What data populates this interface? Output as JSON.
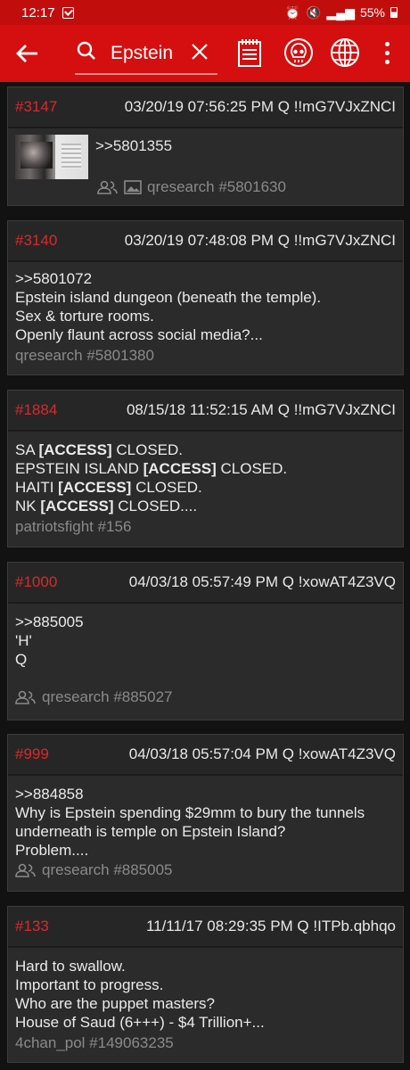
{
  "status_bar": {
    "time": "12:17",
    "battery": "55%"
  },
  "toolbar": {
    "search_text": "Epstein"
  },
  "posts": [
    {
      "num": "#3147",
      "meta": "03/20/19 07:56:25 PM Q !!mG7VJxZNCI",
      "body": [
        ">>5801355"
      ],
      "footer": "qresearch #5801630"
    },
    {
      "num": "#3140",
      "meta": "03/20/19 07:48:08 PM Q !!mG7VJxZNCI",
      "body": [
        ">>5801072",
        "Epstein island dungeon (beneath the temple).",
        "Sex & torture rooms.",
        "Openly flaunt across social media?..."
      ],
      "footer": "qresearch #5801380"
    },
    {
      "num": "#1884",
      "meta": "08/15/18 11:52:15 AM Q !!mG7VJxZNCI",
      "body": [
        {
          "a": "SA ",
          "b": "[ACCESS]",
          "c": " CLOSED."
        },
        {
          "a": "EPSTEIN ISLAND ",
          "b": "[ACCESS]",
          "c": " CLOSED."
        },
        {
          "a": "HAITI ",
          "b": "[ACCESS]",
          "c": " CLOSED."
        },
        {
          "a": "NK ",
          "b": "[ACCESS]",
          "c": " CLOSED...."
        }
      ],
      "footer": "patriotsfight #156"
    },
    {
      "num": "#1000",
      "meta": "04/03/18 05:57:49 PM Q !xowAT4Z3VQ",
      "body": [
        ">>885005",
        "'H'",
        "Q"
      ],
      "footer": "qresearch #885027"
    },
    {
      "num": "#999",
      "meta": "04/03/18 05:57:04 PM Q !xowAT4Z3VQ",
      "body": [
        ">>884858",
        "Why is Epstein spending $29mm to bury the tunnels",
        "underneath is temple on Epstein Island?",
        "Problem...."
      ],
      "footer": "qresearch #885005"
    },
    {
      "num": "#133",
      "meta": "11/11/17 08:29:35 PM Q !ITPb.qbhqo",
      "body": [
        "Hard to swallow.",
        "Important to progress.",
        "Who are the puppet masters?",
        "House of Saud (6+++) - $4 Trillion+..."
      ],
      "footer": "4chan_pol #149063235"
    }
  ],
  "icons": {
    "back": "arrow-left-icon",
    "search": "search-icon",
    "clear": "close-icon",
    "notes": "notepad-icon",
    "skull": "skull-icon",
    "globe": "globe-icon",
    "more": "more-vert-icon",
    "people": "people-icon",
    "image": "image-icon"
  },
  "colors": {
    "toolbar": "#d50f0f",
    "post_number": "#d82a2a",
    "background": "#121212",
    "card": "#2b2b2b"
  }
}
